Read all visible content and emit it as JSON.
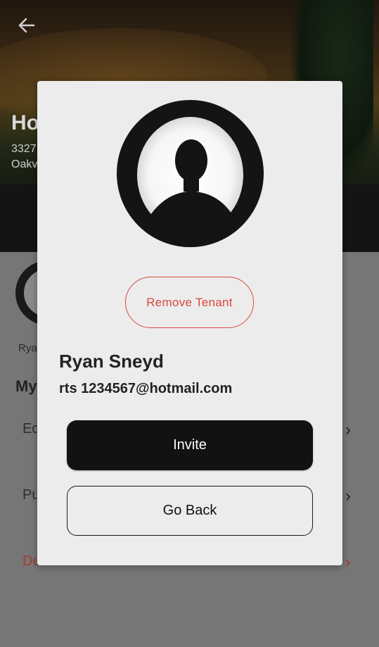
{
  "background": {
    "house_title": "Ho",
    "address_line1": "3327",
    "address_line2": "Oakv",
    "tenant_name_short": "Rya",
    "section_title": "My",
    "rows": [
      {
        "label": "Ed"
      },
      {
        "label": "Pu"
      },
      {
        "label": "Delete House"
      }
    ]
  },
  "modal": {
    "remove_label": "Remove  Tenant",
    "tenant_name": "Ryan Sneyd",
    "tenant_email": "rts 1234567@hotmail.com",
    "invite_label": "Invite",
    "go_back_label": "Go Back"
  },
  "colors": {
    "danger": "#d9473f",
    "primary": "#121212",
    "modal_bg": "#ececec"
  }
}
